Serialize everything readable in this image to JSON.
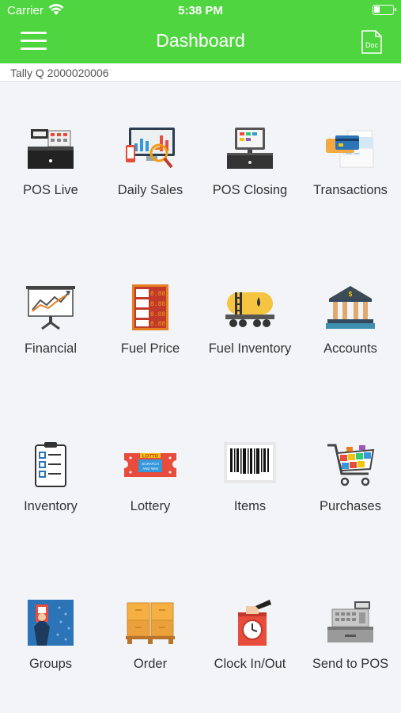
{
  "status_bar": {
    "carrier": "Carrier",
    "time": "5:38 PM"
  },
  "header": {
    "title": "Dashboard",
    "doc_icon_text": "Doc",
    "accent_color": "#4fd53f"
  },
  "store": {
    "name": "Tally Q 2000020006"
  },
  "tiles": [
    {
      "label": "POS Live",
      "icon": "cash-register-icon"
    },
    {
      "label": "Daily Sales",
      "icon": "sales-monitor-icon"
    },
    {
      "label": "POS Closing",
      "icon": "pos-terminal-icon"
    },
    {
      "label": "Transactions",
      "icon": "credit-card-icon"
    },
    {
      "label": "Financial",
      "icon": "chart-board-icon"
    },
    {
      "label": "Fuel Price",
      "icon": "fuel-price-board-icon"
    },
    {
      "label": "Fuel Inventory",
      "icon": "fuel-tanker-icon"
    },
    {
      "label": "Accounts",
      "icon": "bank-icon"
    },
    {
      "label": "Inventory",
      "icon": "checklist-icon"
    },
    {
      "label": "Lottery",
      "icon": "lotto-ticket-icon"
    },
    {
      "label": "Items",
      "icon": "barcode-icon"
    },
    {
      "label": "Purchases",
      "icon": "shopping-cart-icon"
    },
    {
      "label": "Groups",
      "icon": "groups-icon"
    },
    {
      "label": "Order",
      "icon": "boxes-pallet-icon"
    },
    {
      "label": "Clock In/Out",
      "icon": "punch-clock-icon"
    },
    {
      "label": "Send to POS",
      "icon": "register-machine-icon"
    }
  ]
}
